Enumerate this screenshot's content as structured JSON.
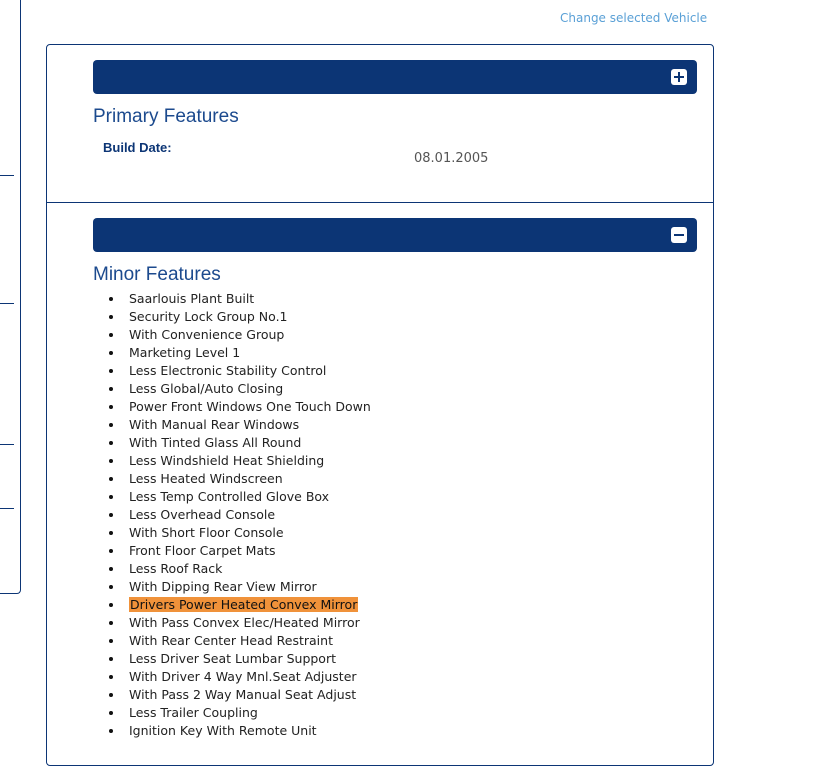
{
  "header": {
    "change_vehicle_link": "Change selected Vehicle"
  },
  "primary": {
    "title": "Primary Features",
    "toggle_icon": "plus-box-icon",
    "build_date_label": "Build Date:",
    "build_date_value": "08.01.2005"
  },
  "minor": {
    "title": "Minor Features",
    "toggle_icon": "minus-box-icon",
    "highlight_color": "#f0923a",
    "items": [
      {
        "label": "Saarlouis Plant Built"
      },
      {
        "label": "Security Lock Group No.1"
      },
      {
        "label": "With Convenience Group"
      },
      {
        "label": "Marketing Level 1"
      },
      {
        "label": "Less Electronic Stability Control"
      },
      {
        "label": "Less Global/Auto Closing"
      },
      {
        "label": "Power Front Windows One Touch Down"
      },
      {
        "label": "With Manual Rear Windows"
      },
      {
        "label": "With Tinted Glass All Round"
      },
      {
        "label": "Less Windshield Heat Shielding"
      },
      {
        "label": "Less Heated Windscreen"
      },
      {
        "label": "Less Temp Controlled Glove Box"
      },
      {
        "label": "Less Overhead Console"
      },
      {
        "label": "With Short Floor Console"
      },
      {
        "label": "Front Floor Carpet Mats"
      },
      {
        "label": "Less Roof Rack"
      },
      {
        "label": "With Dipping Rear View Mirror"
      },
      {
        "label": "Drivers Power Heated Convex Mirror",
        "highlighted": true
      },
      {
        "label": "With Pass Convex Elec/Heated Mirror"
      },
      {
        "label": "With Rear Center Head Restraint"
      },
      {
        "label": "Less Driver Seat Lumbar Support"
      },
      {
        "label": "With Driver 4 Way Mnl.Seat Adjuster"
      },
      {
        "label": "With Pass 2 Way Manual Seat Adjust"
      },
      {
        "label": "Less Trailer Coupling"
      },
      {
        "label": "Ignition Key With Remote Unit"
      }
    ]
  },
  "colors": {
    "primary_navy": "#0c3575",
    "title_blue": "#1c4a8e",
    "link_blue": "#5aa0d6"
  }
}
